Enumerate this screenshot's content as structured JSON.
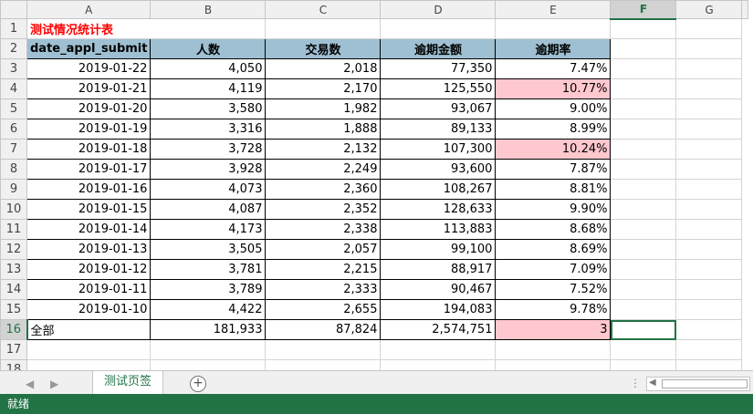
{
  "columns": [
    "A",
    "B",
    "C",
    "D",
    "E",
    "F",
    "G"
  ],
  "rows": [
    "1",
    "2",
    "3",
    "4",
    "5",
    "6",
    "7",
    "8",
    "9",
    "10",
    "11",
    "12",
    "13",
    "14",
    "15",
    "16",
    "17",
    "18"
  ],
  "title": "测试情况统计表",
  "headers": [
    "date_appl_submit",
    "人数",
    "交易数",
    "逾期金额",
    "逾期率"
  ],
  "data": [
    [
      "2019-01-22",
      "4,050",
      "2,018",
      "77,350",
      "7.47%"
    ],
    [
      "2019-01-21",
      "4,119",
      "2,170",
      "125,550",
      "10.77%"
    ],
    [
      "2019-01-20",
      "3,580",
      "1,982",
      "93,067",
      "9.00%"
    ],
    [
      "2019-01-19",
      "3,316",
      "1,888",
      "89,133",
      "8.99%"
    ],
    [
      "2019-01-18",
      "3,728",
      "2,132",
      "107,300",
      "10.24%"
    ],
    [
      "2019-01-17",
      "3,928",
      "2,249",
      "93,600",
      "7.87%"
    ],
    [
      "2019-01-16",
      "4,073",
      "2,360",
      "108,267",
      "8.81%"
    ],
    [
      "2019-01-15",
      "4,087",
      "2,352",
      "128,633",
      "9.90%"
    ],
    [
      "2019-01-14",
      "4,173",
      "2,338",
      "113,883",
      "8.68%"
    ],
    [
      "2019-01-13",
      "3,505",
      "2,057",
      "99,100",
      "8.69%"
    ],
    [
      "2019-01-12",
      "3,781",
      "2,215",
      "88,917",
      "7.09%"
    ],
    [
      "2019-01-11",
      "3,789",
      "2,333",
      "90,467",
      "7.52%"
    ],
    [
      "2019-01-10",
      "4,422",
      "2,655",
      "194,083",
      "9.78%"
    ]
  ],
  "highlight_rows": [
    1,
    4
  ],
  "total": [
    "全部",
    "181,933",
    "87,824",
    "2,574,751",
    "3"
  ],
  "sheet_tab": "测试页签",
  "status_text": "就绪",
  "accent_color": "#217346",
  "header_fill": "#9fc0d2",
  "highlight_fill": "#ffc7ce",
  "title_color": "#ff0000"
}
